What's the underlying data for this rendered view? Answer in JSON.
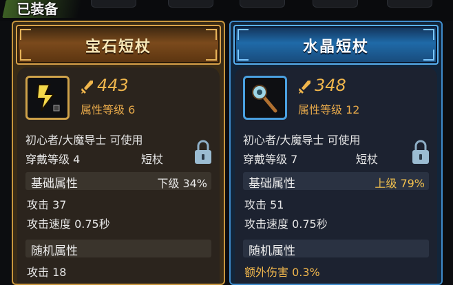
{
  "equipped_label": "已装备",
  "cards": [
    {
      "name": "宝石短杖",
      "power": "443",
      "grade": "属性等级 6",
      "usable": "初心者/大魔导士 可使用",
      "wear_level": "穿戴等级 4",
      "weapon_type": "短杖",
      "base_title": "基础属性",
      "base_tier": "下级",
      "base_pct": "34%",
      "attack": "攻击 37",
      "attack_speed": "攻击速度 0.75秒",
      "random_title": "随机属性",
      "random_line": "攻击 18",
      "theme": "gold"
    },
    {
      "name": "水晶短杖",
      "power": "348",
      "grade": "属性等级 12",
      "usable": "初心者/大魔导士 可使用",
      "wear_level": "穿戴等级 7",
      "weapon_type": "短杖",
      "base_title": "基础属性",
      "base_tier": "上级",
      "base_pct": "79%",
      "attack": "攻击 51",
      "attack_speed": "攻击速度 0.75秒",
      "random_title": "随机属性",
      "random_line": "额外伤害 0.3%",
      "theme": "blue"
    }
  ],
  "colors": {
    "gold_accent": "#c8963d",
    "blue_accent": "#3f8ccc",
    "power": "#f0b64c",
    "tier_high": "#f2c14e"
  },
  "icons": [
    "sword-power-icon",
    "lightning-staff-icon",
    "crystal-staff-icon",
    "lock-icon"
  ]
}
